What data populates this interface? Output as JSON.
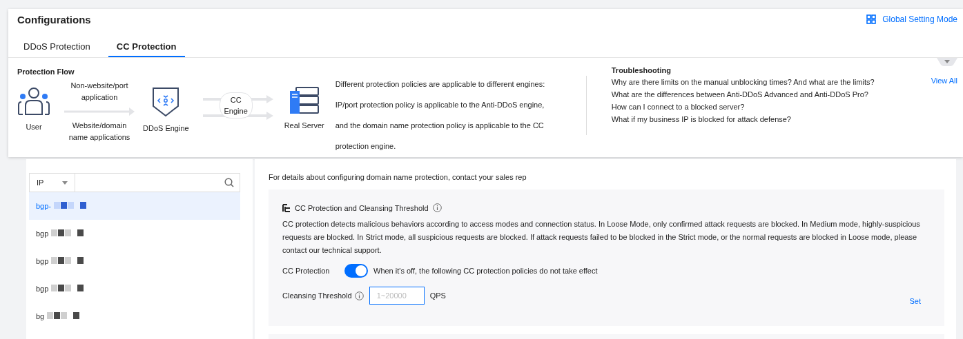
{
  "header": {
    "title": "Configurations",
    "global_setting": "Global Setting Mode"
  },
  "tabs": [
    {
      "label": "DDoS Protection",
      "selected": false
    },
    {
      "label": "CC Protection",
      "selected": true
    }
  ],
  "protection_flow": {
    "title": "Protection Flow",
    "user": "User",
    "path_top": "Non-website/port application",
    "path_bottom": "Website/domain name applications",
    "ddos_engine": "DDoS Engine",
    "cc_engine": "CC Engine",
    "real_server": "Real Server",
    "description": [
      "Different protection policies are applicable to different engines:",
      "IP/port protection policy is applicable to the Anti-DDoS engine,",
      "and the domain name protection policy is applicable to the CC",
      "protection engine."
    ]
  },
  "troubleshooting": {
    "title": "Troubleshooting",
    "view_all": "View All",
    "questions": [
      "Why are there limits on the manual unblocking times? And what are the limits?",
      "What are the differences between Anti-DDoS Advanced and Anti-DDoS Pro?",
      "How can I connect to a blocked server?",
      "What if my business IP is blocked for attack defense?"
    ]
  },
  "search": {
    "type": "IP"
  },
  "instances": [
    {
      "name": "bgp-",
      "selected": true
    },
    {
      "name": "bgp",
      "selected": false
    },
    {
      "name": "bgp",
      "selected": false
    },
    {
      "name": "bgp",
      "selected": false
    },
    {
      "name": "bg",
      "selected": false
    }
  ],
  "notice": "For details about configuring domain name protection, contact your sales rep",
  "cc_section": {
    "title": "CC Protection and Cleansing Threshold",
    "description": "CC protection detects malicious behaviors according to access modes and connection status. In Loose Mode, only confirmed attack requests are blocked. In Medium mode, highly-suspicious requests are blocked. In Strict mode, all suspicious requests are blocked. If attack requests failed to be blocked in the Strict mode, or the normal requests are blocked in Loose mode, please contact our technical support.",
    "toggle_label": "CC Protection",
    "toggle_on": true,
    "toggle_hint": "When it's off, the following CC protection policies do not take effect",
    "threshold_label": "Cleansing Threshold",
    "threshold_placeholder": "1~20000",
    "threshold_unit": "QPS",
    "set": "Set"
  }
}
